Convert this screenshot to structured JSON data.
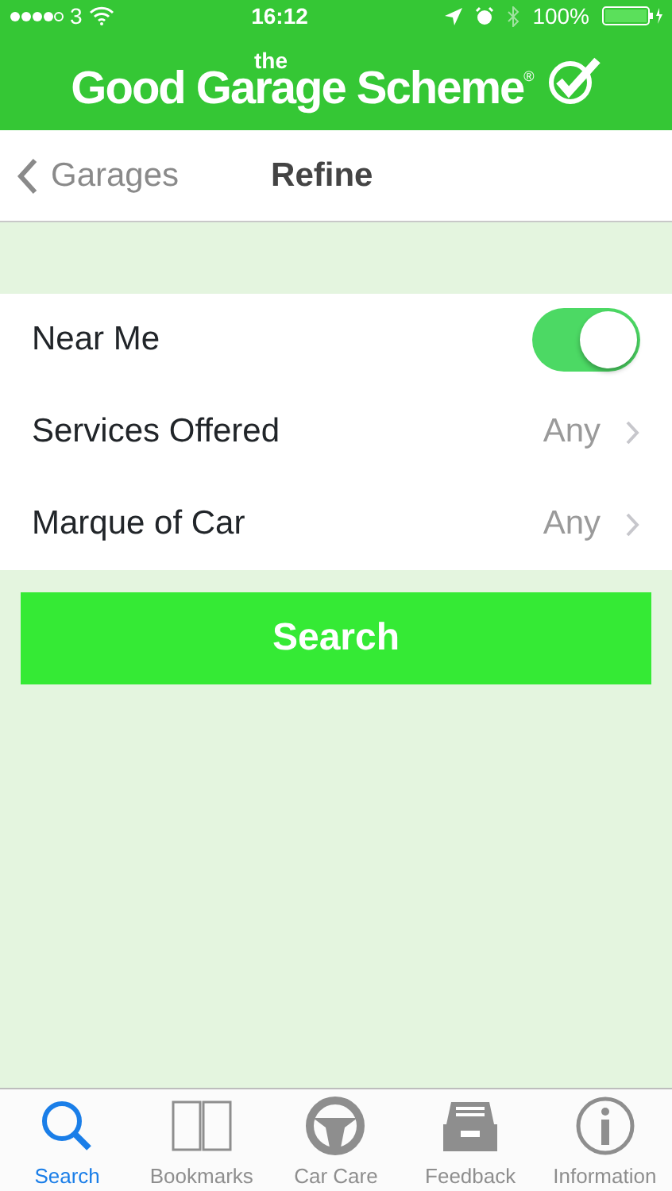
{
  "status_bar": {
    "carrier": "3",
    "time": "16:12",
    "battery": "100%"
  },
  "header": {
    "logo_small": "the",
    "logo": "Good Garage Scheme",
    "logo_mark": "®"
  },
  "nav_bar": {
    "back": "Garages",
    "title": "Refine"
  },
  "rows": [
    {
      "kind": "toggle",
      "label": "Near Me",
      "on": true
    },
    {
      "kind": "disclosure",
      "label": "Services Offered",
      "value": "Any"
    },
    {
      "kind": "disclosure",
      "label": "Marque of Car",
      "value": "Any"
    }
  ],
  "search_button": "Search",
  "tabs": [
    {
      "label": "Search",
      "selected": true
    },
    {
      "label": "Bookmarks",
      "selected": false
    },
    {
      "label": "Car Care",
      "selected": false
    },
    {
      "label": "Feedback",
      "selected": false
    },
    {
      "label": "Information",
      "selected": false
    }
  ]
}
